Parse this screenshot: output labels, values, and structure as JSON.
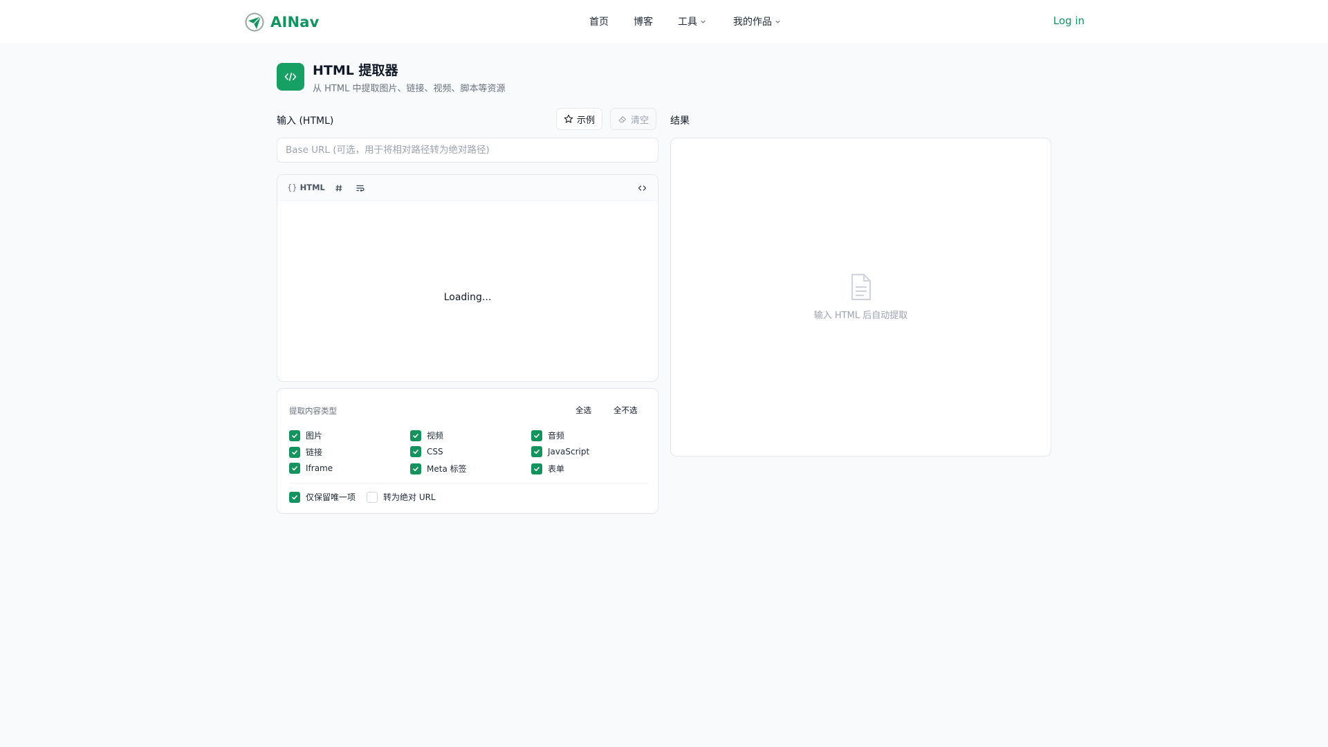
{
  "brand": {
    "name": "AINav",
    "color": "#15935f"
  },
  "nav": {
    "home": "首页",
    "blog": "博客",
    "tools": "工具",
    "works": "我的作品",
    "login": "Log in"
  },
  "header": {
    "title": "HTML 提取器",
    "subtitle": "从 HTML 中提取图片、链接、视频、脚本等资源",
    "icon": "code-icon"
  },
  "input": {
    "label": "输入 (HTML)",
    "example_button": "示例",
    "clear_button": "清空",
    "base_url_placeholder": "Base URL (可选，用于将相对路径转为绝对路径)",
    "editor_lang": "HTML",
    "editor_status": "Loading..."
  },
  "options": {
    "title": "提取内容类型",
    "select_all": "全选",
    "select_none": "全不选",
    "types": [
      {
        "label": "图片",
        "checked": true
      },
      {
        "label": "视频",
        "checked": true
      },
      {
        "label": "音频",
        "checked": true
      },
      {
        "label": "链接",
        "checked": true
      },
      {
        "label": "CSS",
        "checked": true
      },
      {
        "label": "JavaScript",
        "checked": true
      },
      {
        "label": "Iframe",
        "checked": true
      },
      {
        "label": "Meta 标签",
        "checked": true
      },
      {
        "label": "表单",
        "checked": true
      }
    ],
    "unique_only": {
      "label": "仅保留唯一项",
      "checked": true
    },
    "absolute_url": {
      "label": "转为绝对 URL",
      "checked": false
    }
  },
  "result": {
    "label": "结果",
    "empty_text": "输入 HTML 后自动提取",
    "empty_icon": "document-icon"
  }
}
